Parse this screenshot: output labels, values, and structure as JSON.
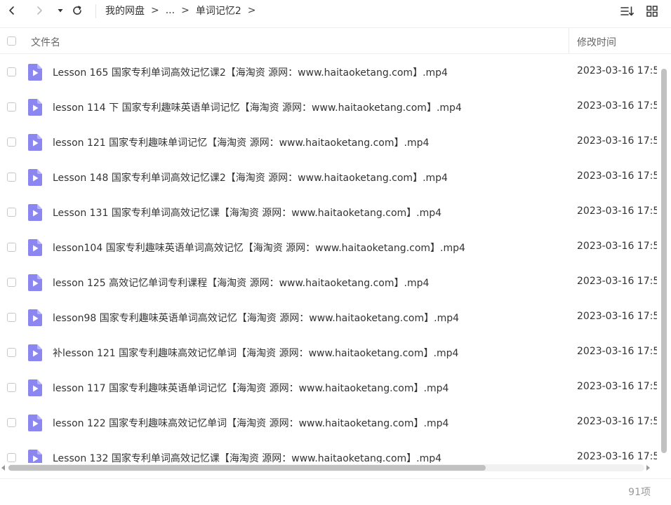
{
  "toolbar": {
    "breadcrumb": [
      "我的网盘",
      "...",
      "单词记忆2"
    ],
    "breadcrumb_separator": ">",
    "icons": [
      "back-arrow-icon",
      "forward-arrow-icon",
      "history-dropdown-icon",
      "refresh-icon",
      "sort-icon",
      "grid-view-icon"
    ]
  },
  "header": {
    "name_column": "文件名",
    "time_column": "修改时间"
  },
  "files": [
    {
      "name": "Lesson 165 国家专利单词高效记忆课2【海淘资 源网：www.haitaoketang.com】.mp4",
      "time": "2023-03-16 17:5"
    },
    {
      "name": "lesson 114 下 国家专利趣味英语单词记忆【海淘资 源网：www.haitaoketang.com】.mp4",
      "time": "2023-03-16 17:5"
    },
    {
      "name": "lesson 121 国家专利趣味单词记忆【海淘资 源网：www.haitaoketang.com】.mp4",
      "time": "2023-03-16 17:5"
    },
    {
      "name": "Lesson 148 国家专利单词高效记忆课2【海淘资 源网：www.haitaoketang.com】.mp4",
      "time": "2023-03-16 17:5"
    },
    {
      "name": "Lesson 131 国家专利单词高效记忆课【海淘资 源网：www.haitaoketang.com】.mp4",
      "time": "2023-03-16 17:5"
    },
    {
      "name": "lesson104 国家专利趣味英语单词高效记忆【海淘资 源网：www.haitaoketang.com】.mp4",
      "time": "2023-03-16 17:5"
    },
    {
      "name": "lesson 125 高效记忆单词专利课程【海淘资 源网：www.haitaoketang.com】.mp4",
      "time": "2023-03-16 17:5"
    },
    {
      "name": "lesson98 国家专利趣味英语单词高效记忆【海淘资 源网：www.haitaoketang.com】.mp4",
      "time": "2023-03-16 17:5"
    },
    {
      "name": "补lesson 121 国家专利趣味高效记忆单词【海淘资 源网：www.haitaoketang.com】.mp4",
      "time": "2023-03-16 17:5"
    },
    {
      "name": "lesson 117 国家专利趣味英语单词记忆【海淘资 源网：www.haitaoketang.com】.mp4",
      "time": "2023-03-16 17:5"
    },
    {
      "name": "lesson 122 国家专利趣味高效记忆单词【海淘资 源网：www.haitaoketang.com】.mp4",
      "time": "2023-03-16 17:5"
    },
    {
      "name": "Lesson 132 国家专利单词高效记忆课【海淘资 源网：www.haitaoketang.com】.mp4",
      "time": "2023-03-16 17:5"
    }
  ],
  "file_icon": "video-file-icon",
  "footer": {
    "item_count": "91项"
  },
  "colors": {
    "file_icon": "#8b86f0",
    "text": "#333333",
    "muted": "#999999"
  }
}
